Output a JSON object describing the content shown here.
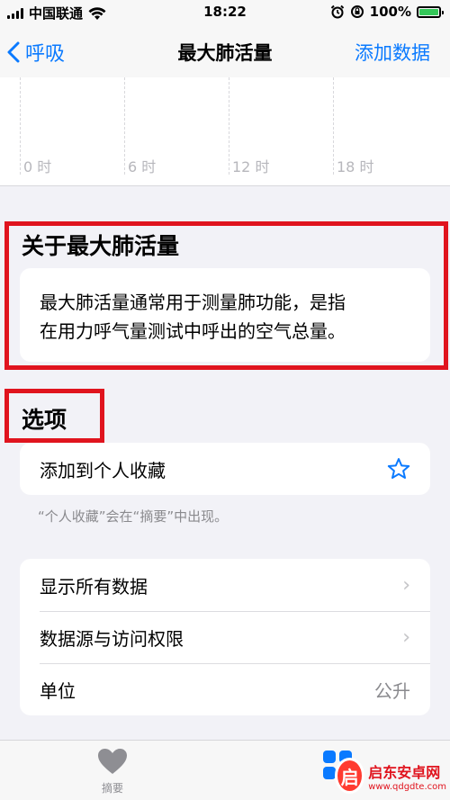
{
  "status_bar": {
    "carrier": "中国联通",
    "time": "18:22",
    "battery": "100%"
  },
  "nav": {
    "back_label": "呼吸",
    "title": "最大肺活量",
    "action_label": "添加数据"
  },
  "chart": {
    "ticks": [
      "0 时",
      "6 时",
      "12 时",
      "18 时"
    ]
  },
  "about": {
    "heading": "关于最大肺活量",
    "body_line1": "最大肺活量通常用于测量肺功能，是指",
    "body_line2": "在用力呼气量测试中呼出的空气总量。"
  },
  "options": {
    "heading": "选项",
    "favorite_label": "添加到个人收藏",
    "favorite_note": "“个人收藏”会在“摘要”中出现。",
    "rows": [
      {
        "label": "显示所有数据"
      },
      {
        "label": "数据源与访问权限"
      },
      {
        "label": "单位",
        "value": "公升"
      }
    ]
  },
  "tab_bar": {
    "summary_label": "摘要"
  },
  "watermark": {
    "logo_char": "启",
    "title": "启东安卓网",
    "url": "www.qdgdte.com"
  },
  "colors": {
    "accent": "#0a7aff",
    "highlight_box": "#e0141e",
    "battery": "#34c759"
  }
}
